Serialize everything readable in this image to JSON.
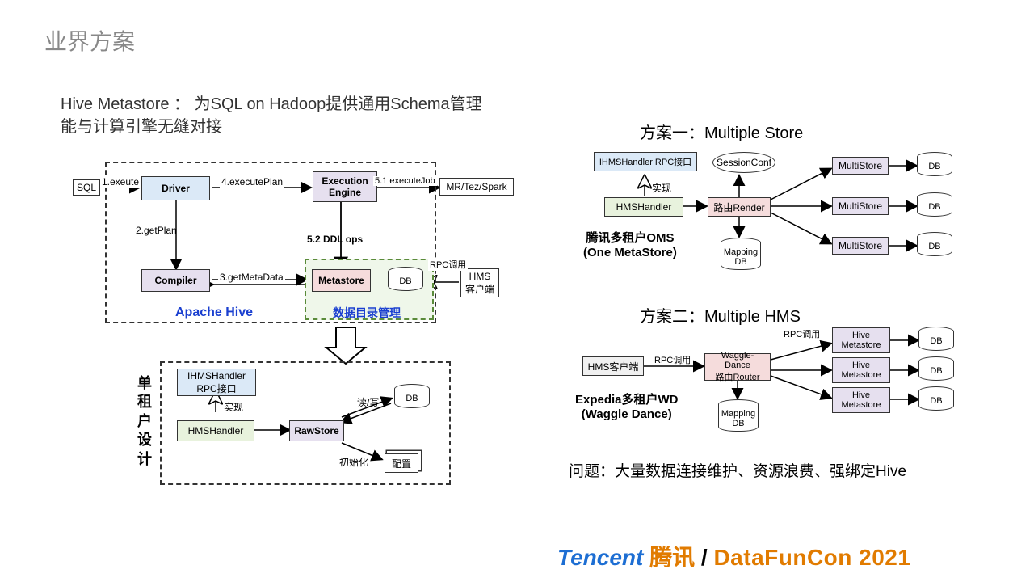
{
  "title": "业界方案",
  "subtitle": "Hive Metastore ： 为SQL on Hadoop提供通用Schema管理\n能与计算引擎无缝对接",
  "scheme1_title": "方案一：Multiple Store",
  "scheme2_title": "方案二：Multiple HMS",
  "problem": "问题：大量数据连接维护、资源浪费、强绑定Hive",
  "apache_hive": "Apache Hive",
  "metastore_label": "数据目录管理",
  "single_tenant_label": "单租户设计",
  "left": {
    "sql": "SQL",
    "exec_call": "1.exeute",
    "driver": "Driver",
    "exec_plan": "4.executePlan",
    "exec_engine": "Execution\nEngine",
    "exec_job": "5.1 executeJob",
    "mr": "MR/Tez/Spark",
    "get_plan": "2.getPlan",
    "ddl": "5.2 DDL ops",
    "compiler": "Compiler",
    "get_meta": "3.getMetaData",
    "metastore": "Metastore",
    "db": "DB",
    "hms_client": "HMS\n客户端",
    "rpc_call": "RPC调用",
    "ihms_rpc": "IHMSHandler\nRPC接口",
    "impl": "实现",
    "hms_handler": "HMSHandler",
    "rawstore": "RawStore",
    "rw": "读/写",
    "init": "初始化",
    "config": "配置"
  },
  "right1": {
    "ihms_rpc": "IHMSHandler RPC接口",
    "impl": "实现",
    "hms_handler": "HMSHandler",
    "session_conf": "SessionConf",
    "router": "路由Render",
    "mapping_db": "Mapping\nDB",
    "multistore": "MultiStore",
    "db": "DB",
    "caption": "腾讯多租户OMS\n(One MetaStore)"
  },
  "right2": {
    "hms_client": "HMS客户端",
    "rpc_call": "RPC调用",
    "router": "Waggle-Dance\n路由Router",
    "mapping_db": "Mapping\nDB",
    "hive_ms": "Hive\nMetastore",
    "db": "DB",
    "caption": "Expedia多租户WD\n(Waggle Dance)"
  },
  "footer": {
    "tencent_en": "Tencent",
    "tencent_cn": "腾讯",
    "sep": " / ",
    "conf": "DataFunCon 2021"
  }
}
